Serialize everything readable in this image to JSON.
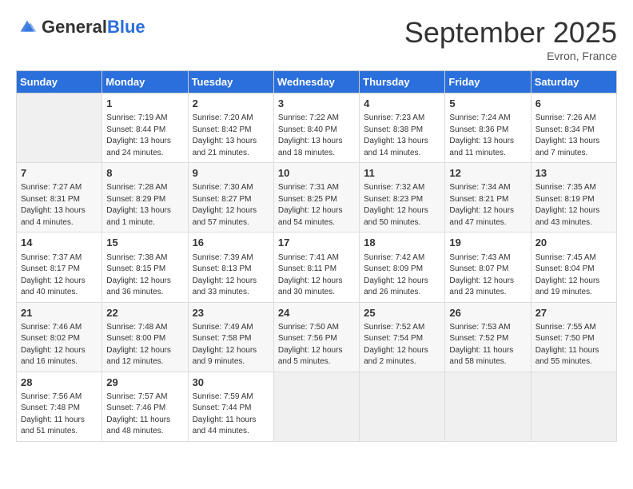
{
  "header": {
    "logo_general": "General",
    "logo_blue": "Blue",
    "month_title": "September 2025",
    "location": "Evron, France"
  },
  "days_of_week": [
    "Sunday",
    "Monday",
    "Tuesday",
    "Wednesday",
    "Thursday",
    "Friday",
    "Saturday"
  ],
  "weeks": [
    [
      {
        "day": "",
        "info": ""
      },
      {
        "day": "1",
        "info": "Sunrise: 7:19 AM\nSunset: 8:44 PM\nDaylight: 13 hours\nand 24 minutes."
      },
      {
        "day": "2",
        "info": "Sunrise: 7:20 AM\nSunset: 8:42 PM\nDaylight: 13 hours\nand 21 minutes."
      },
      {
        "day": "3",
        "info": "Sunrise: 7:22 AM\nSunset: 8:40 PM\nDaylight: 13 hours\nand 18 minutes."
      },
      {
        "day": "4",
        "info": "Sunrise: 7:23 AM\nSunset: 8:38 PM\nDaylight: 13 hours\nand 14 minutes."
      },
      {
        "day": "5",
        "info": "Sunrise: 7:24 AM\nSunset: 8:36 PM\nDaylight: 13 hours\nand 11 minutes."
      },
      {
        "day": "6",
        "info": "Sunrise: 7:26 AM\nSunset: 8:34 PM\nDaylight: 13 hours\nand 7 minutes."
      }
    ],
    [
      {
        "day": "7",
        "info": "Sunrise: 7:27 AM\nSunset: 8:31 PM\nDaylight: 13 hours\nand 4 minutes."
      },
      {
        "day": "8",
        "info": "Sunrise: 7:28 AM\nSunset: 8:29 PM\nDaylight: 13 hours\nand 1 minute."
      },
      {
        "day": "9",
        "info": "Sunrise: 7:30 AM\nSunset: 8:27 PM\nDaylight: 12 hours\nand 57 minutes."
      },
      {
        "day": "10",
        "info": "Sunrise: 7:31 AM\nSunset: 8:25 PM\nDaylight: 12 hours\nand 54 minutes."
      },
      {
        "day": "11",
        "info": "Sunrise: 7:32 AM\nSunset: 8:23 PM\nDaylight: 12 hours\nand 50 minutes."
      },
      {
        "day": "12",
        "info": "Sunrise: 7:34 AM\nSunset: 8:21 PM\nDaylight: 12 hours\nand 47 minutes."
      },
      {
        "day": "13",
        "info": "Sunrise: 7:35 AM\nSunset: 8:19 PM\nDaylight: 12 hours\nand 43 minutes."
      }
    ],
    [
      {
        "day": "14",
        "info": "Sunrise: 7:37 AM\nSunset: 8:17 PM\nDaylight: 12 hours\nand 40 minutes."
      },
      {
        "day": "15",
        "info": "Sunrise: 7:38 AM\nSunset: 8:15 PM\nDaylight: 12 hours\nand 36 minutes."
      },
      {
        "day": "16",
        "info": "Sunrise: 7:39 AM\nSunset: 8:13 PM\nDaylight: 12 hours\nand 33 minutes."
      },
      {
        "day": "17",
        "info": "Sunrise: 7:41 AM\nSunset: 8:11 PM\nDaylight: 12 hours\nand 30 minutes."
      },
      {
        "day": "18",
        "info": "Sunrise: 7:42 AM\nSunset: 8:09 PM\nDaylight: 12 hours\nand 26 minutes."
      },
      {
        "day": "19",
        "info": "Sunrise: 7:43 AM\nSunset: 8:07 PM\nDaylight: 12 hours\nand 23 minutes."
      },
      {
        "day": "20",
        "info": "Sunrise: 7:45 AM\nSunset: 8:04 PM\nDaylight: 12 hours\nand 19 minutes."
      }
    ],
    [
      {
        "day": "21",
        "info": "Sunrise: 7:46 AM\nSunset: 8:02 PM\nDaylight: 12 hours\nand 16 minutes."
      },
      {
        "day": "22",
        "info": "Sunrise: 7:48 AM\nSunset: 8:00 PM\nDaylight: 12 hours\nand 12 minutes."
      },
      {
        "day": "23",
        "info": "Sunrise: 7:49 AM\nSunset: 7:58 PM\nDaylight: 12 hours\nand 9 minutes."
      },
      {
        "day": "24",
        "info": "Sunrise: 7:50 AM\nSunset: 7:56 PM\nDaylight: 12 hours\nand 5 minutes."
      },
      {
        "day": "25",
        "info": "Sunrise: 7:52 AM\nSunset: 7:54 PM\nDaylight: 12 hours\nand 2 minutes."
      },
      {
        "day": "26",
        "info": "Sunrise: 7:53 AM\nSunset: 7:52 PM\nDaylight: 11 hours\nand 58 minutes."
      },
      {
        "day": "27",
        "info": "Sunrise: 7:55 AM\nSunset: 7:50 PM\nDaylight: 11 hours\nand 55 minutes."
      }
    ],
    [
      {
        "day": "28",
        "info": "Sunrise: 7:56 AM\nSunset: 7:48 PM\nDaylight: 11 hours\nand 51 minutes."
      },
      {
        "day": "29",
        "info": "Sunrise: 7:57 AM\nSunset: 7:46 PM\nDaylight: 11 hours\nand 48 minutes."
      },
      {
        "day": "30",
        "info": "Sunrise: 7:59 AM\nSunset: 7:44 PM\nDaylight: 11 hours\nand 44 minutes."
      },
      {
        "day": "",
        "info": ""
      },
      {
        "day": "",
        "info": ""
      },
      {
        "day": "",
        "info": ""
      },
      {
        "day": "",
        "info": ""
      }
    ]
  ]
}
